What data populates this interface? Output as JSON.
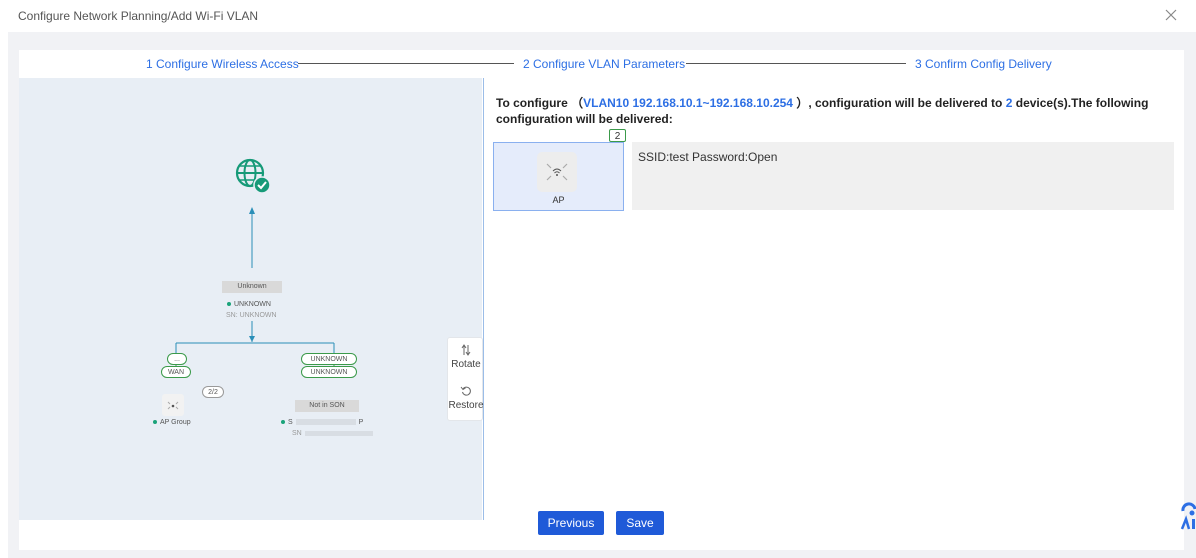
{
  "window": {
    "title": "Configure Network Planning/Add Wi-Fi VLAN",
    "close_icon": "close-icon"
  },
  "steps": [
    {
      "label": "1 Configure Wireless Access"
    },
    {
      "label": "2 Configure VLAN Parameters"
    },
    {
      "label": "3 Confirm Config Delivery"
    }
  ],
  "topology": {
    "internet_icon": "globe-check-icon",
    "root": {
      "name": "Unknown",
      "status": "UNKNOWN",
      "sn": "SN: UNKNOWN"
    },
    "left_branch": {
      "top_label": "...",
      "wan_label": "WAN",
      "count": "2/2",
      "group_label": "AP Group"
    },
    "right_branch": {
      "label1": "UNKNOWN",
      "label2": "UNKNOWN",
      "tag": "Not in SON",
      "status_prefix": "S",
      "status_suffix": "P",
      "sn_prefix": "SN"
    }
  },
  "controls": {
    "rotate": "Rotate",
    "restore": "Restore"
  },
  "details": {
    "prefix": "To configure",
    "paren_open": "（",
    "vlan": "VLAN10 192.168.10.1~192.168.10.254",
    "paren_close": "）",
    "middle": ", configuration will be delivered to",
    "device_count": "2",
    "suffix": "device(s).The following configuration will be delivered:",
    "badge": "2",
    "device_label": "AP",
    "config": "SSID:test Password:Open"
  },
  "buttons": {
    "previous": "Previous",
    "save": "Save"
  },
  "colors": {
    "accent": "#2d6fe4",
    "button": "#1f5ad8",
    "online": "#1aa37a",
    "panel": "#e8eef5"
  }
}
